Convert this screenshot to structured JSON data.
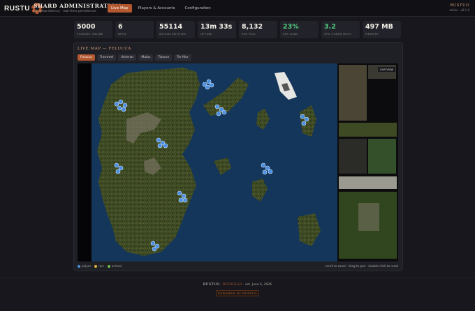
{
  "app": {
    "logo_text": "RUSTU",
    "title": "SHARD ADMINISTRATION",
    "subtitle": "ultra-low latency · real-time persistence"
  },
  "nav": {
    "items": [
      {
        "label": "Live Map",
        "active": true
      },
      {
        "label": "Players & Accounts",
        "active": false
      },
      {
        "label": "Configuration",
        "active": false
      }
    ]
  },
  "user": {
    "name": "RUSTUO",
    "status": "online · v0.1.0"
  },
  "stats": [
    {
      "value": "5000",
      "label": "PLAYERS ONLINE",
      "accent": false
    },
    {
      "value": "6",
      "label": "NPCS",
      "accent": false
    },
    {
      "value": "55114",
      "label": "WORLD ENTITIES",
      "accent": false
    },
    {
      "value": "13m 33s",
      "label": "UPTIME",
      "accent": false
    },
    {
      "value": "8,132",
      "label": "SIM TICK",
      "accent": false
    },
    {
      "value": "23%",
      "label": "SIM LOAD",
      "accent": true
    },
    {
      "value": "3.2",
      "label": "CPU CORES BUSY",
      "accent": true
    },
    {
      "value": "497 MB",
      "label": "MEMORY",
      "accent": false
    }
  ],
  "map": {
    "title": "LIVE MAP — FELUCCA",
    "facets": [
      {
        "label": "Felucca",
        "active": true
      },
      {
        "label": "Trammel",
        "active": false
      },
      {
        "label": "Ilshenar",
        "active": false
      },
      {
        "label": "Malas",
        "active": false
      },
      {
        "label": "Tokuno",
        "active": false
      },
      {
        "label": "Ter Mur",
        "active": false
      }
    ],
    "overview_label": "overview",
    "legend": [
      {
        "label": "player",
        "color": "#4a8fe0"
      },
      {
        "label": "npc",
        "color": "#e0b440"
      },
      {
        "label": "animal",
        "color": "#6fbf4f"
      }
    ],
    "hint": "scroll to zoom · drag to pan · double-click to reset"
  },
  "footer": {
    "brand": "RUSTUO",
    "sep1": " · ",
    "engine": "REDHEAD",
    "sep2": " · ",
    "established": "est. June 6, 2026",
    "powered": "POWERED BY RUSTUO"
  },
  "colors": {
    "accent": "#b4582f",
    "ocean": "#14365a",
    "land": "#3c4a23",
    "player": "#4a8fe0",
    "good": "#4fc77a"
  }
}
